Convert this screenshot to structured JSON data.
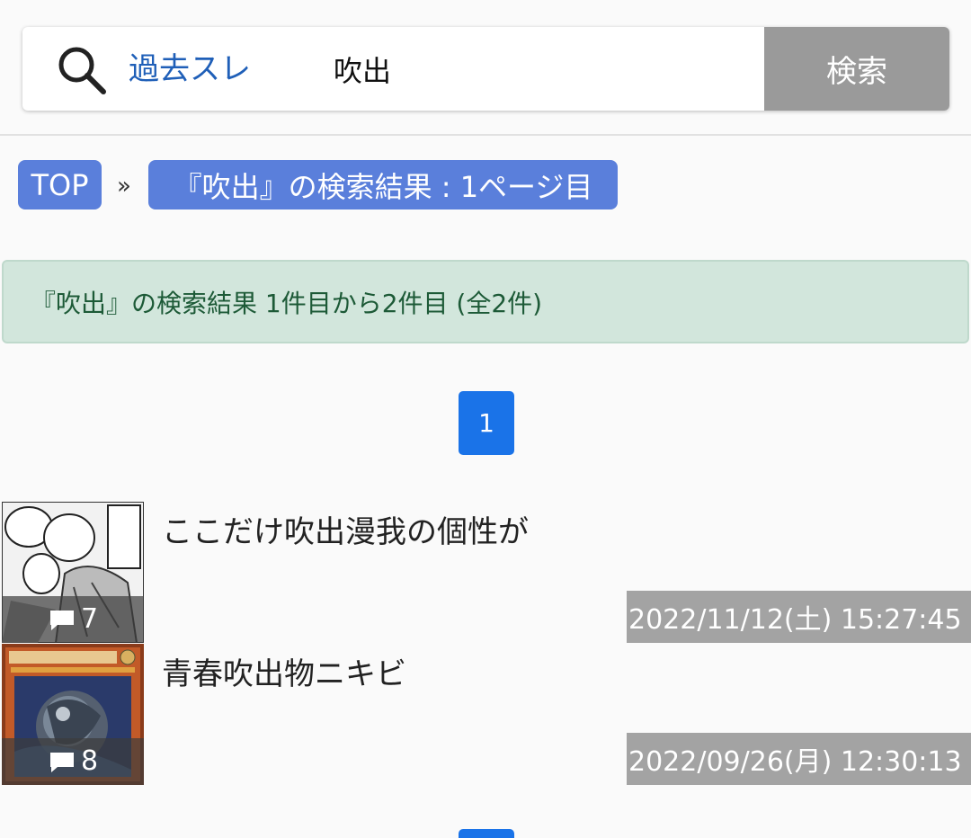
{
  "search": {
    "scope_label": "過去スレ",
    "query": "吹出",
    "button_label": "検索"
  },
  "breadcrumb": {
    "top_label": "TOP",
    "separator": "»",
    "current_label": "『吹出』の検索結果 : 1ページ目"
  },
  "results_summary": "『吹出』の検索結果 1件目から2件目 (全2件)",
  "pagination": {
    "current_page": "1"
  },
  "threads": [
    {
      "title": "ここだけ吹出漫我の個性が",
      "comments": "7",
      "date": "2022/11/12(土) 15:27:45"
    },
    {
      "title": "青春吹出物ニキビ",
      "comments": "8",
      "date": "2022/09/26(月) 12:30:13"
    }
  ],
  "colors": {
    "accent": "#5a7fdb",
    "page_button": "#1a73e8",
    "search_button": "#9a9a9a",
    "info_bg": "#d2e6dc",
    "info_text": "#1d5a37"
  }
}
